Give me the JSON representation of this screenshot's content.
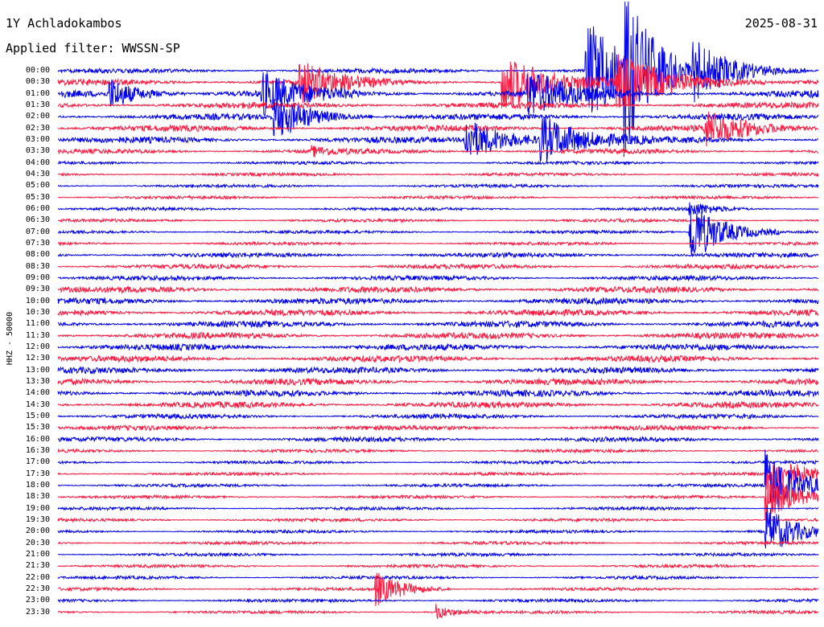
{
  "header": {
    "station": "1Y Achladokambos",
    "date": "2025-08-31",
    "filter": "Applied filter: WWSSN-SP"
  },
  "chart_data": {
    "type": "line",
    "ylabel": "HHZ - 50000",
    "title": "",
    "xlabel": "",
    "categories": [
      "00:00",
      "00:30",
      "01:00",
      "01:30",
      "02:00",
      "02:30",
      "03:00",
      "03:30",
      "04:00",
      "04:30",
      "05:00",
      "05:30",
      "06:00",
      "06:30",
      "07:00",
      "07:30",
      "08:00",
      "08:30",
      "09:00",
      "09:30",
      "10:00",
      "10:30",
      "11:00",
      "11:30",
      "12:00",
      "12:30",
      "13:00",
      "13:30",
      "14:00",
      "14:30",
      "15:00",
      "15:30",
      "16:00",
      "16:30",
      "17:00",
      "17:30",
      "18:00",
      "18:30",
      "19:00",
      "19:30",
      "20:00",
      "20:30",
      "21:00",
      "21:30",
      "22:00",
      "22:30",
      "23:00",
      "23:30"
    ],
    "trace_colors": [
      "#0000ee",
      "#ff1a40"
    ],
    "noise_level": [
      3,
      4,
      5,
      4,
      4,
      4,
      4,
      3,
      2,
      2,
      2,
      2,
      2,
      2,
      2,
      2,
      3,
      3,
      3,
      4,
      4,
      4,
      4,
      4,
      4,
      4,
      4,
      4,
      4,
      4,
      3,
      3,
      3,
      2,
      2,
      2,
      2,
      2,
      2,
      2,
      2,
      2,
      2,
      2,
      2,
      2,
      2,
      2
    ],
    "events": [
      {
        "trace": "00:00",
        "minute": 20.8,
        "amplitude": 80,
        "duration": 1.2
      },
      {
        "trace": "00:00",
        "minute": 22.3,
        "amplitude": 100,
        "duration": 1.0
      },
      {
        "trace": "00:00",
        "minute": 25.0,
        "amplitude": 40,
        "duration": 1.5
      },
      {
        "trace": "00:30",
        "minute": 9.5,
        "amplitude": 30,
        "duration": 1.2
      },
      {
        "trace": "00:30",
        "minute": 17.5,
        "amplitude": 40,
        "duration": 1.5
      },
      {
        "trace": "00:30",
        "minute": 22.0,
        "amplitude": 35,
        "duration": 2.0
      },
      {
        "trace": "01:00",
        "minute": 2.0,
        "amplitude": 20,
        "duration": 1.0
      },
      {
        "trace": "01:00",
        "minute": 8.0,
        "amplitude": 28,
        "duration": 1.3
      },
      {
        "trace": "01:00",
        "minute": 18.5,
        "amplitude": 30,
        "duration": 1.5
      },
      {
        "trace": "02:00",
        "minute": 8.5,
        "amplitude": 30,
        "duration": 1.3
      },
      {
        "trace": "02:30",
        "minute": 25.5,
        "amplitude": 22,
        "duration": 1.5
      },
      {
        "trace": "03:00",
        "minute": 16.0,
        "amplitude": 28,
        "duration": 1.5
      },
      {
        "trace": "03:00",
        "minute": 19.0,
        "amplitude": 30,
        "duration": 1.5
      },
      {
        "trace": "03:30",
        "minute": 10.0,
        "amplitude": 6,
        "duration": 0.8
      },
      {
        "trace": "06:00",
        "minute": 24.9,
        "amplitude": 10,
        "duration": 0.8
      },
      {
        "trace": "07:00",
        "minute": 24.9,
        "amplitude": 42,
        "duration": 1.2
      },
      {
        "trace": "17:30",
        "minute": 27.9,
        "amplitude": 30,
        "duration": 1.2
      },
      {
        "trace": "18:00",
        "minute": 27.9,
        "amplitude": 45,
        "duration": 1.3
      },
      {
        "trace": "18:30",
        "minute": 27.9,
        "amplitude": 30,
        "duration": 1.2
      },
      {
        "trace": "20:00",
        "minute": 27.9,
        "amplitude": 35,
        "duration": 1.0
      },
      {
        "trace": "22:30",
        "minute": 12.5,
        "amplitude": 22,
        "duration": 1.0
      },
      {
        "trace": "23:30",
        "minute": 14.9,
        "amplitude": 10,
        "duration": 0.6
      }
    ]
  }
}
